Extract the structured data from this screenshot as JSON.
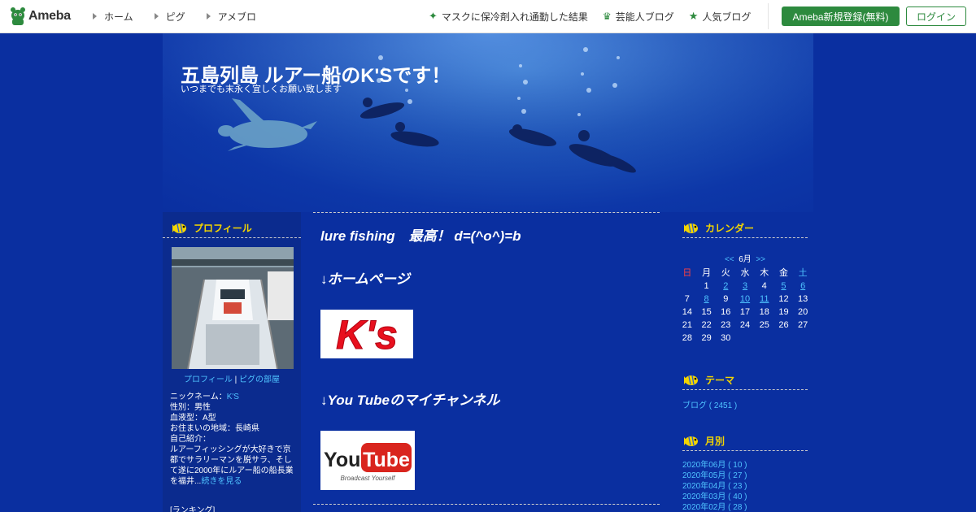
{
  "topbar": {
    "logo_text": "Ameba",
    "nav_left": [
      "ホーム",
      "ピグ",
      "アメブロ"
    ],
    "nav_right": [
      {
        "icon": "star-icon",
        "label": "マスクに保冷剤入れ通勤した結果"
      },
      {
        "icon": "crown-icon",
        "label": "芸能人ブログ"
      },
      {
        "icon": "star-icon",
        "label": "人気ブログ"
      }
    ],
    "register_label": "Ameba新規登録(無料)",
    "login_label": "ログイン",
    "brand_color": "#2d8a3e"
  },
  "header": {
    "title": "五島列島 ルアー船のK'Sです！",
    "subtitle": "いつまでも末永く宜しくお願い致します"
  },
  "profile": {
    "heading": "プロフィール",
    "links": {
      "profile": "プロフィール",
      "sep": " | ",
      "room": "ピグの部屋"
    },
    "nickname_label": "ニックネーム：",
    "nickname": "K'S",
    "gender": "性別：男性",
    "blood": "血液型：A型",
    "area": "お住まいの地域：長崎県",
    "intro_label": "自己紹介：",
    "intro": "ルアーフィッシングが大好きで京都でサラリーマンを脱サラ、そして遂に2000年にルアー船の船長業を福井...",
    "more": "続きを見る",
    "ranking": "[ランキング]"
  },
  "main": {
    "post_title": "lure fishing　最高！ d=(^o^)=b",
    "home_heading": "↓ホームページ",
    "ks_logo_text": "K's",
    "youtube_heading": "↓You Tubeのマイチャンネル",
    "youtube_logo": {
      "you": "You",
      "tube": "Tube",
      "tagline": "Broadcast Yourself"
    }
  },
  "calendar": {
    "heading": "カレンダー",
    "prev": "<<",
    "month": "6月",
    "next": ">>",
    "weekdays": [
      "日",
      "月",
      "火",
      "水",
      "木",
      "金",
      "土"
    ],
    "weeks": [
      [
        "",
        "1",
        "2",
        "3",
        "4",
        "5",
        "6"
      ],
      [
        "7",
        "8",
        "9",
        "10",
        "11",
        "12",
        "13"
      ],
      [
        "14",
        "15",
        "16",
        "17",
        "18",
        "19",
        "20"
      ],
      [
        "21",
        "22",
        "23",
        "24",
        "25",
        "26",
        "27"
      ],
      [
        "28",
        "29",
        "30",
        "",
        "",
        "",
        ""
      ]
    ],
    "linked_days": [
      "2",
      "3",
      "5",
      "6",
      "8",
      "10",
      "11"
    ]
  },
  "theme": {
    "heading": "テーマ",
    "items": [
      "ブログ ( 2451 )"
    ]
  },
  "monthly": {
    "heading": "月別",
    "items": [
      "2020年06月 ( 10 )",
      "2020年05月 ( 27 )",
      "2020年04月 ( 23 )",
      "2020年03月 ( 40 )",
      "2020年02月 ( 28 )"
    ]
  }
}
